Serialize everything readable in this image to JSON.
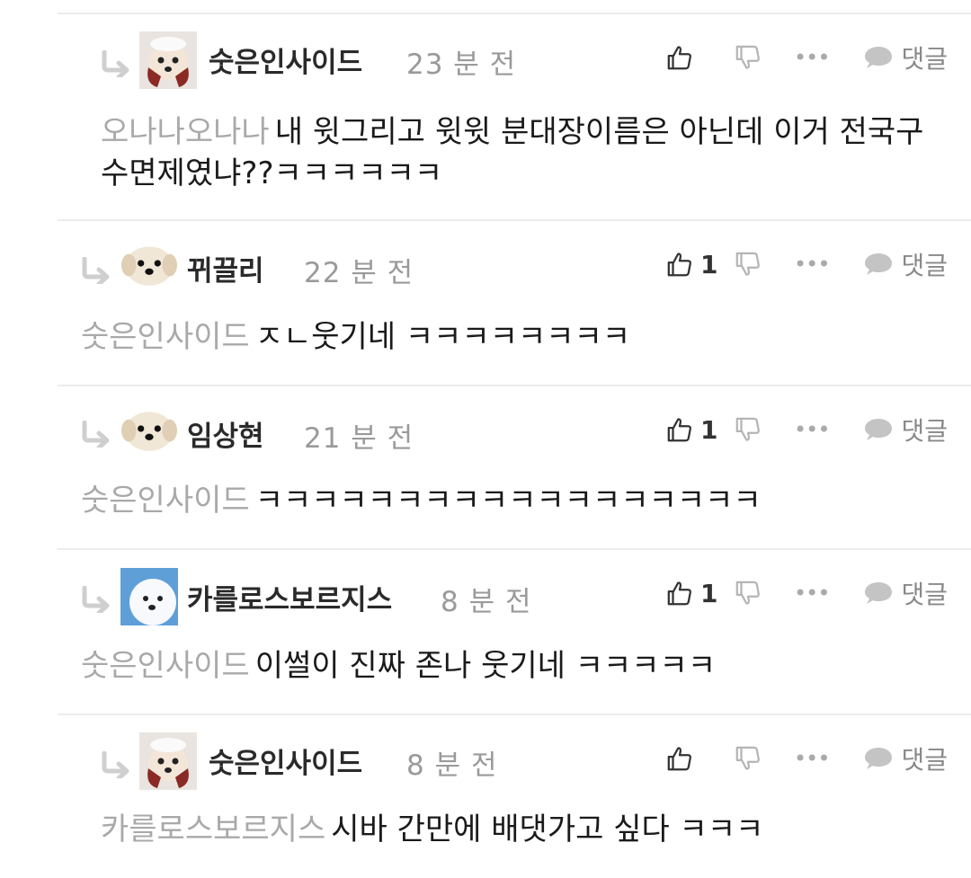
{
  "comments": [
    {
      "author": "숫은인사이드",
      "time": "23 분 전",
      "likes": "",
      "mention": "오나나오나나",
      "text": "내 윗그리고 윗윗 분대장이름은 아닌데 이거 전국구 수면제였냐??ㅋㅋㅋㅋㅋㅋ",
      "reply_label": "댓글",
      "avatar": "face-icon"
    },
    {
      "author": "뀌끌리",
      "time": "22 분 전",
      "likes": "1",
      "mention": "숫은인사이드",
      "text": "ㅈㄴ웃기네 ㅋㅋㅋㅋㅋㅋㅋㅋ",
      "reply_label": "댓글",
      "avatar": "dog-icon"
    },
    {
      "author": "임상현",
      "time": "21 분 전",
      "likes": "1",
      "mention": "숫은인사이드",
      "text": "ㅋㅋㅋㅋㅋㅋㅋㅋㅋㅋㅋㅋㅋㅋㅋㅋㅋㅋ",
      "reply_label": "댓글",
      "avatar": "dog-icon"
    },
    {
      "author": "카를로스보르지스",
      "time": "8 분 전",
      "likes": "1",
      "mention": "숫은인사이드",
      "text": "이썰이 진짜 존나 웃기네 ㅋㅋㅋㅋㅋ",
      "reply_label": "댓글",
      "avatar": "white-dog-icon"
    },
    {
      "author": "숫은인사이드",
      "time": "8 분 전",
      "likes": "",
      "mention": "카를로스보르지스",
      "text": "시바 간만에 배댓가고 싶다 ㅋㅋㅋ",
      "reply_label": "댓글",
      "avatar": "face-icon"
    }
  ]
}
